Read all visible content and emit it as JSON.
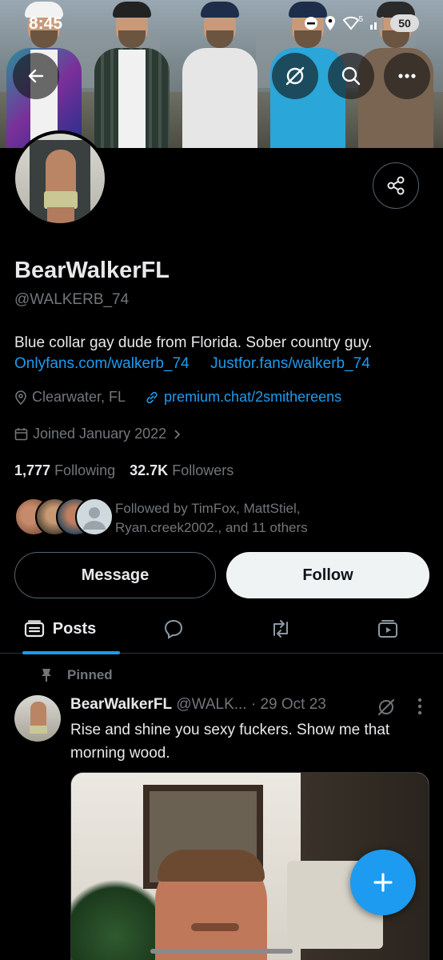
{
  "status_bar": {
    "time": "8:45",
    "signal_label": "5",
    "battery": "50"
  },
  "profile": {
    "name": "BearWalkerFL",
    "handle": "@WALKERB_74",
    "bio": "Blue collar gay dude from Florida. Sober country guy.",
    "bio_links": [
      "Onlyfans.com/walkerb_74",
      "Justfor.fans/walkerb_74"
    ],
    "location": "Clearwater, FL",
    "website": "premium.chat/2smithereens",
    "joined": "Joined January 2022",
    "following_count": "1,777",
    "following_label": "Following",
    "followers_count": "32.7K",
    "followers_label": "Followers",
    "followed_by_line1": "Followed by TimFox, MattStiel,",
    "followed_by_line2": "Ryan.creek2002., and 11 others"
  },
  "actions": {
    "message": "Message",
    "follow": "Follow"
  },
  "tabs": {
    "posts": "Posts"
  },
  "pinned_post": {
    "pinned_label": "Pinned",
    "author": "BearWalkerFL",
    "handle_and_date": "@WALK... · 29 Oct 23",
    "text": "Rise and shine you sexy fuckers. Show me that morning wood."
  },
  "colors": {
    "accent": "#1d9bf0",
    "background": "#000000",
    "muted": "#71767b"
  },
  "icons": [
    "back-arrow-icon",
    "grok-icon",
    "search-icon",
    "more-icon",
    "share-icon",
    "location-icon",
    "link-icon",
    "calendar-icon",
    "chevron-right-icon",
    "posts-icon",
    "replies-icon",
    "retweet-icon",
    "media-icon",
    "pin-icon",
    "compose-plus-icon"
  ]
}
